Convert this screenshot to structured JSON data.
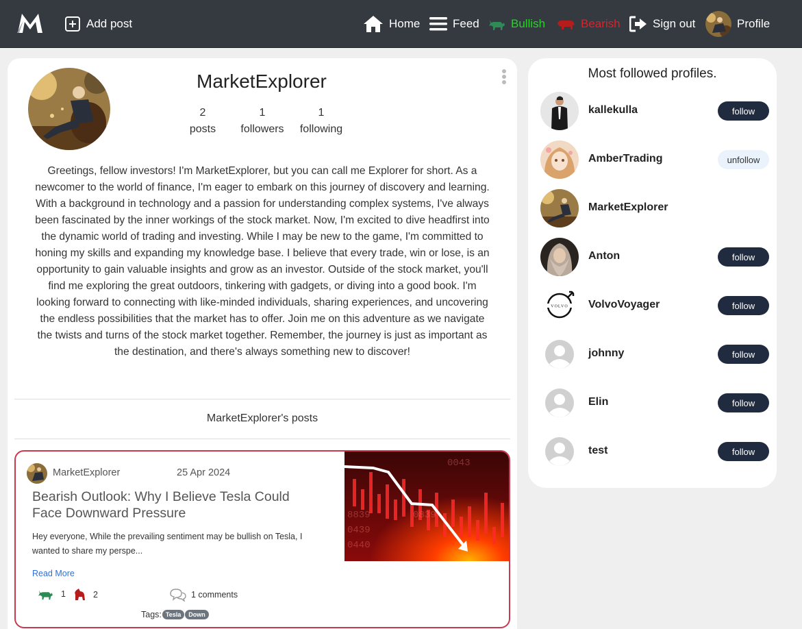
{
  "nav": {
    "add_post": "Add post",
    "home": "Home",
    "feed": "Feed",
    "bullish": "Bullish",
    "bearish": "Bearish",
    "sign_out": "Sign out",
    "profile": "Profile",
    "colors": {
      "background": "#343a40",
      "bullish": "#2bd12b",
      "bearish": "#e0202a"
    }
  },
  "profile": {
    "username": "MarketExplorer",
    "stats": [
      {
        "value": "2",
        "label": "posts"
      },
      {
        "value": "1",
        "label": "followers"
      },
      {
        "value": "1",
        "label": "following"
      }
    ],
    "bio": "Greetings, fellow investors! I'm MarketExplorer, but you can call me Explorer for short. As a newcomer to the world of finance, I'm eager to embark on this journey of discovery and learning. With a background in technology and a passion for understanding complex systems, I've always been fascinated by the inner workings of the stock market. Now, I'm excited to dive headfirst into the dynamic world of trading and investing. While I may be new to the game, I'm committed to honing my skills and expanding my knowledge base. I believe that every trade, win or lose, is an opportunity to gain valuable insights and grow as an investor. Outside of the stock market, you'll find me exploring the great outdoors, tinkering with gadgets, or diving into a good book. I'm looking forward to connecting with like-minded individuals, sharing experiences, and uncovering the endless possibilities that the market has to offer. Join me on this adventure as we navigate the twists and turns of the stock market together. Remember, the journey is just as important as the destination, and there's always something new to discover!",
    "posts_heading": "MarketExplorer's posts"
  },
  "posts": [
    {
      "author": "MarketExplorer",
      "date": "25 Apr 2024",
      "title": "Bearish Outlook: Why I Believe Tesla Could Face Downward Pressure",
      "excerpt": "Hey everyone, While the prevailing sentiment may be bullish on Tesla, I wanted to share my perspe...",
      "read_more": "Read More",
      "bull_votes": "1",
      "bear_votes": "2",
      "comments": "1 comments",
      "tags_label": "Tags:",
      "tags": [
        "Tesla",
        "Down"
      ],
      "border_color": "#c9394e"
    }
  ],
  "sidebar": {
    "title": "Most followed profiles.",
    "profiles": [
      {
        "name": "kallekulla",
        "button": "follow"
      },
      {
        "name": "AmberTrading",
        "button": "unfollow"
      },
      {
        "name": "MarketExplorer",
        "button": ""
      },
      {
        "name": "Anton",
        "button": "follow"
      },
      {
        "name": "VolvoVoyager",
        "button": "follow"
      },
      {
        "name": "johnny",
        "button": "follow"
      },
      {
        "name": "Elin",
        "button": "follow"
      },
      {
        "name": "test",
        "button": "follow"
      }
    ],
    "button_color": "#212b40"
  }
}
